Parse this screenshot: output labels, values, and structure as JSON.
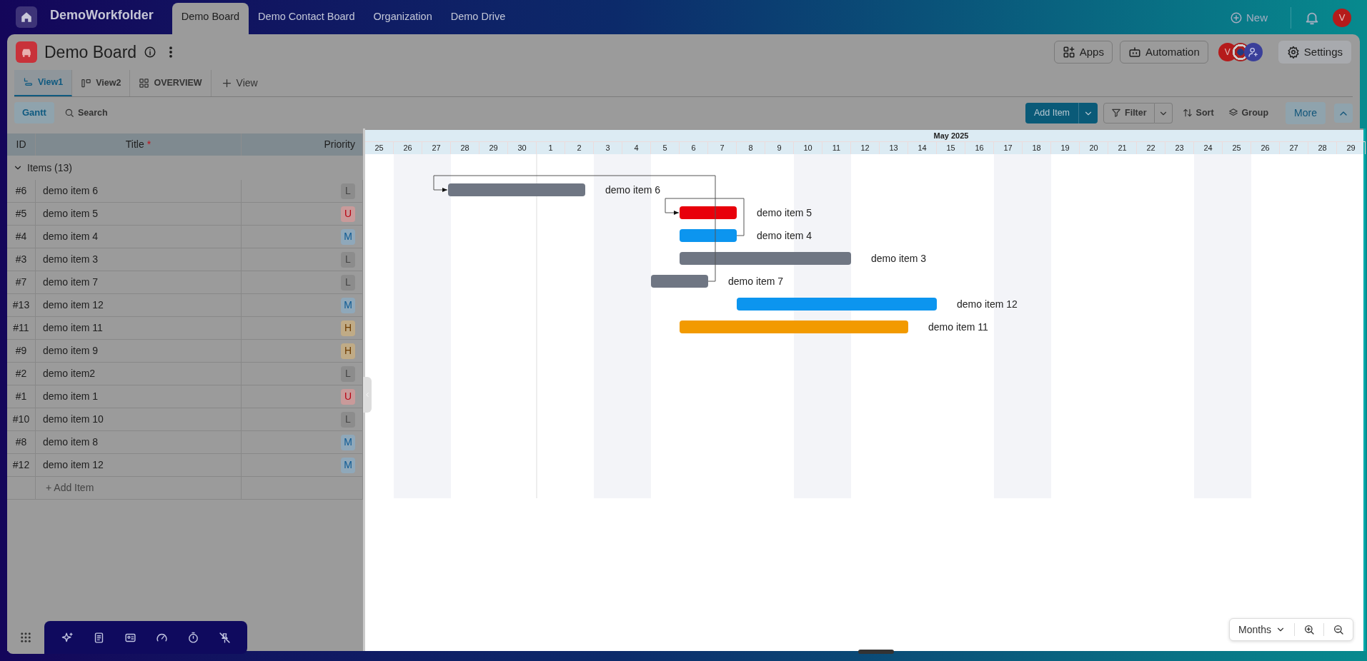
{
  "top_bar": {
    "workspace": "DemoWorkfolder",
    "tabs": [
      {
        "label": "Demo Board",
        "selected": true
      },
      {
        "label": "Demo Contact Board",
        "selected": false
      },
      {
        "label": "Organization",
        "selected": false
      },
      {
        "label": "Demo Drive",
        "selected": false
      }
    ],
    "new_label": "New",
    "user_initial": "V"
  },
  "board": {
    "title": "Demo Board",
    "apps": "Apps",
    "automation": "Automation",
    "member_initial": "V",
    "settings": "Settings",
    "views": [
      {
        "label": "View1",
        "kind": "gantt",
        "selected": true
      },
      {
        "label": "View2",
        "kind": "timeline",
        "selected": false
      },
      {
        "label": "OVERVIEW",
        "kind": "grid",
        "selected": false
      }
    ],
    "add_view": "View"
  },
  "toolbar": {
    "modes": [
      {
        "label": "Gantt",
        "selected": true
      }
    ],
    "search": "Search",
    "add_item": "Add Item",
    "filter": "Filter",
    "sort": "Sort",
    "group": "Group",
    "more": "More"
  },
  "table": {
    "columns": [
      {
        "label": "ID"
      },
      {
        "label": "Title",
        "required_mark": "*"
      },
      {
        "label": "Priority"
      }
    ],
    "group": {
      "label": "Items (13)",
      "expanded": true
    },
    "rows": [
      {
        "id": "#6",
        "title": "demo item 6",
        "priority": "L",
        "kind": "low"
      },
      {
        "id": "#5",
        "title": "demo item 5",
        "priority": "U",
        "kind": "urgent"
      },
      {
        "id": "#4",
        "title": "demo item 4",
        "priority": "M",
        "kind": "medium"
      },
      {
        "id": "#3",
        "title": "demo item 3",
        "priority": "L",
        "kind": "low"
      },
      {
        "id": "#7",
        "title": "demo item 7",
        "priority": "L",
        "kind": "low"
      },
      {
        "id": "#13",
        "title": "demo item 12",
        "priority": "M",
        "kind": "medium"
      },
      {
        "id": "#11",
        "title": "demo item 11",
        "priority": "H",
        "kind": "high"
      },
      {
        "id": "#9",
        "title": "demo item 9",
        "priority": "H",
        "kind": "high"
      },
      {
        "id": "#2",
        "title": "demo item2",
        "priority": "L",
        "kind": "low"
      },
      {
        "id": "#1",
        "title": "demo item 1",
        "priority": "U",
        "kind": "urgent"
      },
      {
        "id": "#10",
        "title": "demo item 10",
        "priority": "L",
        "kind": "low"
      },
      {
        "id": "#8",
        "title": "demo item 8",
        "priority": "M",
        "kind": "medium"
      },
      {
        "id": "#12",
        "title": "demo item 12",
        "priority": "M",
        "kind": "medium"
      }
    ],
    "add_item": "+ Add Item"
  },
  "gantt": {
    "month": "May 2025",
    "days": [
      "25",
      "26",
      "27",
      "28",
      "29",
      "30",
      "1",
      "2",
      "3",
      "4",
      "5",
      "6",
      "7",
      "8",
      "9",
      "10",
      "11",
      "12",
      "13",
      "14",
      "15",
      "16",
      "17",
      "18",
      "19",
      "20",
      "21",
      "22",
      "23",
      "24",
      "25",
      "26",
      "27",
      "28",
      "29"
    ],
    "tasks": [
      {
        "label": "demo item 6",
        "color": "#6f7683"
      },
      {
        "label": "demo item 5",
        "color": "#e8000b"
      },
      {
        "label": "demo item 4",
        "color": "#0c95ef"
      },
      {
        "label": "demo item 3",
        "color": "#6f7683"
      },
      {
        "label": "demo item 7",
        "color": "#6f7683"
      },
      {
        "label": "demo item 12",
        "color": "#0c95ef"
      },
      {
        "label": "demo item 11",
        "color": "#f29a00"
      }
    ],
    "zoom_scale": "Months"
  }
}
